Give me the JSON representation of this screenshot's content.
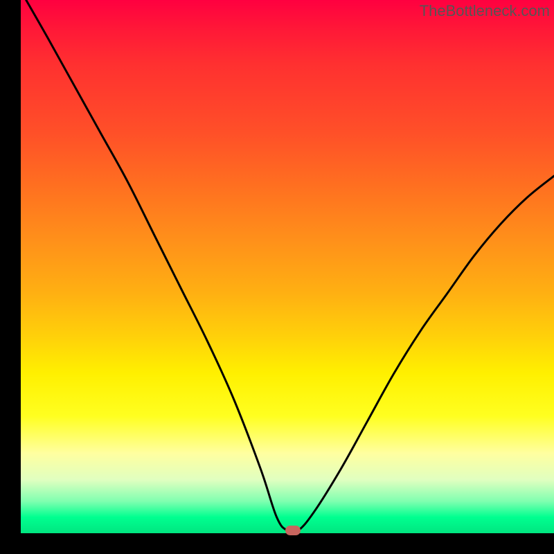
{
  "attribution": "TheBottleneck.com",
  "chart_data": {
    "type": "line",
    "title": "",
    "xlabel": "",
    "ylabel": "",
    "xlim": [
      0,
      100
    ],
    "ylim": [
      0,
      100
    ],
    "series": [
      {
        "name": "bottleneck-curve",
        "x": [
          1,
          5,
          10,
          15,
          20,
          25,
          30,
          35,
          40,
          45,
          48,
          50,
          52,
          55,
          60,
          65,
          70,
          75,
          80,
          85,
          90,
          95,
          100
        ],
        "y": [
          100,
          93,
          84,
          75,
          66,
          56,
          46,
          36,
          25,
          12,
          3,
          0.5,
          0.5,
          4,
          12,
          21,
          30,
          38,
          45,
          52,
          58,
          63,
          67
        ]
      }
    ],
    "marker": {
      "x": 51,
      "y": 0.5,
      "color": "#c8655e"
    },
    "background_gradient": {
      "stops": [
        {
          "pos": 0,
          "color": "#ff0040"
        },
        {
          "pos": 25,
          "color": "#ff5028"
        },
        {
          "pos": 50,
          "color": "#ffa016"
        },
        {
          "pos": 70,
          "color": "#fff000"
        },
        {
          "pos": 85,
          "color": "#ffffa0"
        },
        {
          "pos": 100,
          "color": "#00e680"
        }
      ]
    }
  }
}
